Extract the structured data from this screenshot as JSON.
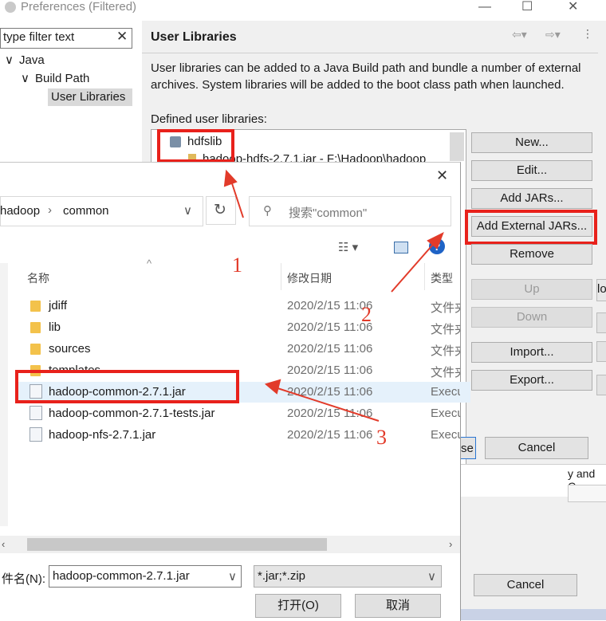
{
  "preferences": {
    "title": "Preferences (Filtered)",
    "filter_text": "type filter text",
    "tree": [
      "Java",
      "Build Path",
      "User Libraries"
    ],
    "page_title": "User Libraries",
    "description": "User libraries can be added to a Java Build path and bundle a number of external archives. System libraries will be added to the boot class path when launched.",
    "defined_label": "Defined user libraries:",
    "library": "hdfslib",
    "library_child": "hadoop-hdfs-2.7.1.jar - F:\\Hadoop\\hadoop",
    "buttons": {
      "new": "New...",
      "edit": "Edit...",
      "add_jars": "Add JARs...",
      "add_external": "Add External JARs...",
      "remove": "Remove",
      "up": "Up",
      "down": "Down",
      "import": "Import...",
      "export": "Export...",
      "apply_close_partial": "se",
      "cancel": "Cancel",
      "cancel2": "Cancel"
    },
    "side_partial": "lo",
    "side_partial2": "y and C"
  },
  "file_dialog": {
    "path": [
      "hadoop",
      "common"
    ],
    "search_placeholder": "搜索\"common\"",
    "columns": {
      "name": "名称",
      "date": "修改日期",
      "type": "类型"
    },
    "files": [
      {
        "name": "jdiff",
        "date": "2020/2/15 11:06",
        "type": "文件夹",
        "kind": "folder"
      },
      {
        "name": "lib",
        "date": "2020/2/15 11:06",
        "type": "文件夹",
        "kind": "folder"
      },
      {
        "name": "sources",
        "date": "2020/2/15 11:06",
        "type": "文件夹",
        "kind": "folder"
      },
      {
        "name": "templates",
        "date": "2020/2/15 11:06",
        "type": "文件夹",
        "kind": "folder"
      },
      {
        "name": "hadoop-common-2.7.1.jar",
        "date": "2020/2/15 11:06",
        "type": "Executable Jar File",
        "kind": "jar"
      },
      {
        "name": "hadoop-common-2.7.1-tests.jar",
        "date": "2020/2/15 11:06",
        "type": "Executable Jar File",
        "kind": "jar"
      },
      {
        "name": "hadoop-nfs-2.7.1.jar",
        "date": "2020/2/15 11:06",
        "type": "Executable Jar File",
        "kind": "jar"
      }
    ],
    "filename_label": "件名(N):",
    "filename_value": "hadoop-common-2.7.1.jar",
    "filetype_value": "*.jar;*.zip",
    "open_button": "打开(O)",
    "cancel_button": "取消"
  },
  "annotations": [
    "1",
    "2",
    "3"
  ],
  "colors": {
    "highlight": "#e8211b",
    "selection": "#e5f1fb"
  }
}
